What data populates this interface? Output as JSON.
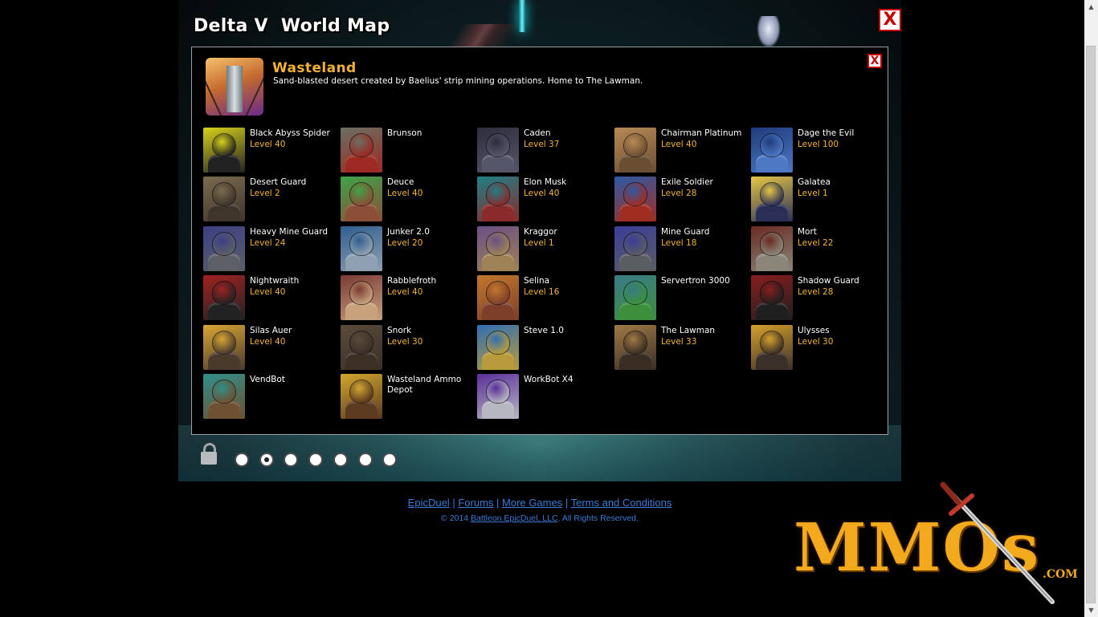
{
  "window": {
    "title": "Delta V  World Map",
    "close_label": "X"
  },
  "zone": {
    "close_label": "X",
    "name": "Wasteland",
    "description": "Sand-blasted desert created by Baelius' strip mining operations. Home to The Lawman."
  },
  "npcs": [
    {
      "name": "Black Abyss Spider",
      "level": "Level 40",
      "colors": [
        "#d8d21a",
        "#222222"
      ]
    },
    {
      "name": "Brunson",
      "level": "",
      "colors": [
        "#6b6f63",
        "#9c2a22"
      ]
    },
    {
      "name": "Caden",
      "level": "Level 37",
      "colors": [
        "#2d2d3d",
        "#56566a"
      ]
    },
    {
      "name": "Chairman Platinum",
      "level": "Level 40",
      "colors": [
        "#b98a55",
        "#6a4e32"
      ]
    },
    {
      "name": "Dage the Evil",
      "level": "Level 100",
      "colors": [
        "#1f3c7a",
        "#4c78c4"
      ]
    },
    {
      "name": "Desert Guard",
      "level": "Level 2",
      "colors": [
        "#7a6a4f",
        "#3f352a"
      ]
    },
    {
      "name": "Deuce",
      "level": "Level 40",
      "colors": [
        "#3fa348",
        "#8b4e36"
      ]
    },
    {
      "name": "Elon Musk",
      "level": "Level 40",
      "colors": [
        "#1f7f86",
        "#8a2b2b"
      ]
    },
    {
      "name": "Exile Soldier",
      "level": "Level 28",
      "colors": [
        "#2e5aa6",
        "#a02d22"
      ]
    },
    {
      "name": "Galatea",
      "level": "Level 1",
      "colors": [
        "#e7c744",
        "#2b2f57"
      ]
    },
    {
      "name": "Heavy Mine Guard",
      "level": "Level 24",
      "colors": [
        "#3d3f86",
        "#5b5f66"
      ]
    },
    {
      "name": "Junker 2.0",
      "level": "Level 20",
      "colors": [
        "#2f5e8f",
        "#8fa0b2"
      ]
    },
    {
      "name": "Kraggor",
      "level": "Level 1",
      "colors": [
        "#6a4e86",
        "#9f8355"
      ]
    },
    {
      "name": "Mine Guard",
      "level": "Level 18",
      "colors": [
        "#3b3d9a",
        "#5a5d62"
      ]
    },
    {
      "name": "Mort",
      "level": "Level 22",
      "colors": [
        "#6a2a22",
        "#8b8679"
      ]
    },
    {
      "name": "Nightwraith",
      "level": "Level 40",
      "colors": [
        "#a22222",
        "#222222"
      ]
    },
    {
      "name": "Rabblefroth",
      "level": "Level 40",
      "colors": [
        "#7a3a35",
        "#c7a27d"
      ]
    },
    {
      "name": "Selina",
      "level": "Level 16",
      "colors": [
        "#c2782c",
        "#7d3f2a"
      ]
    },
    {
      "name": "Servertron 3000",
      "level": "",
      "colors": [
        "#3a7a88",
        "#3d8f3c"
      ]
    },
    {
      "name": "Shadow Guard",
      "level": "Level 28",
      "colors": [
        "#8a1d1d",
        "#1f1f1f"
      ]
    },
    {
      "name": "Silas Auer",
      "level": "Level 40",
      "colors": [
        "#d9a634",
        "#4a3a2c"
      ]
    },
    {
      "name": "Snork",
      "level": "Level 30",
      "colors": [
        "#5a4b3b",
        "#3b2f26"
      ]
    },
    {
      "name": "Steve 1.0",
      "level": "",
      "colors": [
        "#2f6fb5",
        "#b89b3a"
      ]
    },
    {
      "name": "The Lawman",
      "level": "Level 33",
      "colors": [
        "#a07a45",
        "#3a2e24"
      ]
    },
    {
      "name": "Ulysses",
      "level": "Level 30",
      "colors": [
        "#d6a12b",
        "#3b2f2a"
      ]
    },
    {
      "name": "VendBot",
      "level": "",
      "colors": [
        "#2f8f8a",
        "#6d5132"
      ]
    },
    {
      "name": "Wasteland Ammo Depot",
      "level": "",
      "colors": [
        "#d1a72f",
        "#5b3a20"
      ]
    },
    {
      "name": "WorkBot X4",
      "level": "",
      "colors": [
        "#5a2e9a",
        "#b7b7c2"
      ]
    }
  ],
  "pagination": {
    "page_count": 7,
    "active_page": 2
  },
  "footer": {
    "links": [
      "EpicDuel",
      "Forums",
      "More Games",
      "Terms and Conditions"
    ],
    "separator": "|",
    "copyright_prefix": "© 2014",
    "copyright_link": "Battleon EpicDuel, LLC",
    "copyright_suffix": ". All Rights Reserved."
  },
  "watermark": {
    "text": "MMOs",
    "suffix": ".COM",
    "color": "#f3a91c"
  },
  "colors": {
    "level_text": "#f3b233",
    "close_red": "#c40000",
    "link_blue": "#3a7bd5"
  }
}
